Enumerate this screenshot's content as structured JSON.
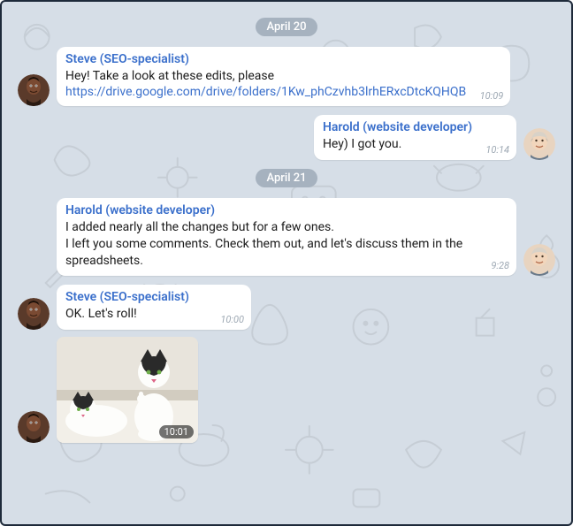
{
  "dates": {
    "d1": "April 20",
    "d2": "April 21"
  },
  "messages": {
    "m1": {
      "sender": "Steve (SEO-specialist)",
      "text": "Hey! Take a look at these edits, please",
      "link": "https://drive.google.com/drive/folders/1Kw_phCzvhb3lrhERxcDtcKQHQB",
      "time": "10:09"
    },
    "m2": {
      "sender": "Harold (website developer)",
      "text": "Hey) I got you.",
      "time": "10:14"
    },
    "m3": {
      "sender": "Harold (website developer)",
      "text": "I added nearly all the changes but for a few ones.\nI left you some comments. Check them out, and let's discuss them in the spreadsheets.",
      "time": "9:28"
    },
    "m4": {
      "sender": "Steve (SEO-specialist)",
      "text": "OK. Let's roll!",
      "time": "10:00"
    },
    "m5": {
      "time": "10:01"
    }
  }
}
